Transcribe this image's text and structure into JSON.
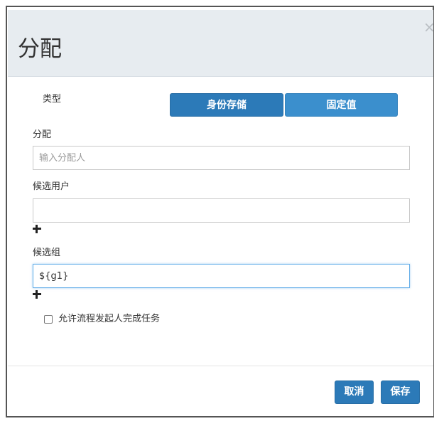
{
  "dialog": {
    "title": "分配",
    "close_glyph": "×"
  },
  "type_row": {
    "label": "类型",
    "options": [
      {
        "label": "身份存储",
        "selected": true
      },
      {
        "label": "固定值",
        "selected": false
      }
    ]
  },
  "assignee": {
    "label": "分配",
    "value": "",
    "placeholder": "输入分配人"
  },
  "candidate_users": {
    "label": "候选用户",
    "value": "",
    "add_icon": "plus-icon"
  },
  "candidate_groups": {
    "label": "候选组",
    "value": "${g1}",
    "add_icon": "plus-icon"
  },
  "allow_initiator": {
    "label": "允许流程发起人完成任务",
    "checked": false
  },
  "footer": {
    "cancel_label": "取消",
    "save_label": "保存"
  },
  "colors": {
    "primary": "#2c7ab8",
    "primary_light": "#3b8fcd",
    "header_bg": "#e7ecf0",
    "focus_border": "#66afe9"
  }
}
